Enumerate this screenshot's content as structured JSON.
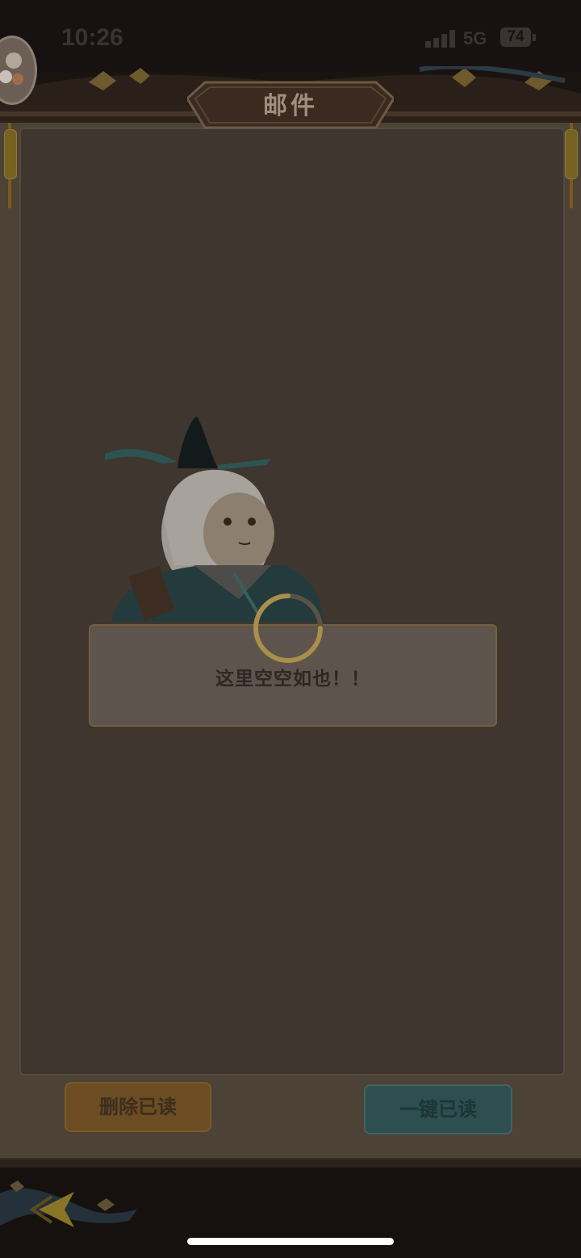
{
  "status_bar": {
    "time": "10:26",
    "network": "5G",
    "battery": "74"
  },
  "header": {
    "title": "邮件"
  },
  "empty_state": {
    "message": "这里空空如也！！"
  },
  "actions": {
    "delete_read_label": "删除已读",
    "mark_all_read_label": "一键已读"
  },
  "colors": {
    "panel": "#4c4235",
    "accent_gold": "#c9a24a",
    "teal_button": "#2e4e4f",
    "brown_button": "#6c4c23"
  },
  "icons": {
    "back": "back-arrow-icon",
    "loading": "loading-spinner-icon"
  }
}
